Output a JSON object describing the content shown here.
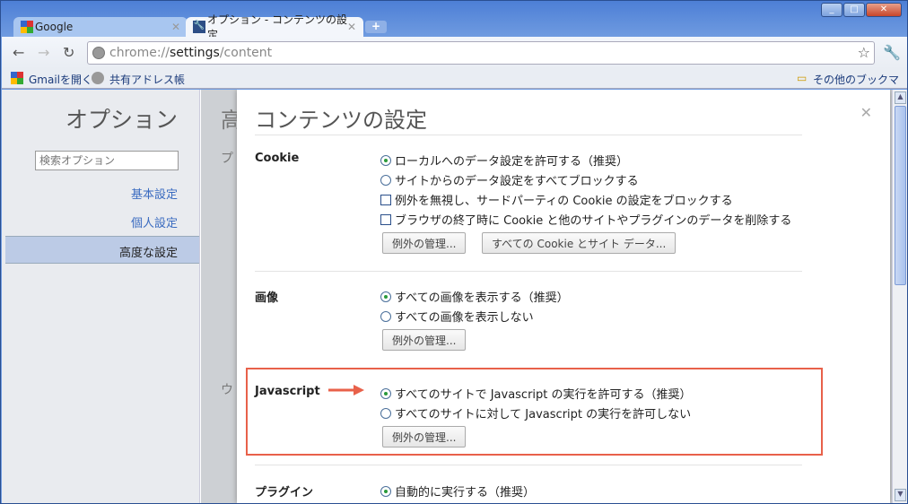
{
  "tabs": [
    {
      "label": "Google",
      "icon": "google-icon"
    },
    {
      "label": "オプション - コンテンツの設定",
      "icon": "wrench-icon"
    }
  ],
  "url": {
    "prefix": "chrome://",
    "host": "settings",
    "path": "/content"
  },
  "bookmarks": [
    {
      "label": "Gmailを開く"
    },
    {
      "label": "共有アドレス帳"
    }
  ],
  "other_bookmarks": "その他のブックマーク",
  "sidebar": {
    "title": "オプション",
    "search_placeholder": "検索オプション",
    "items": [
      {
        "label": "基本設定"
      },
      {
        "label": "個人設定"
      },
      {
        "label": "高度な設定",
        "selected": true
      }
    ]
  },
  "behind": [
    "高",
    "プ",
    "ウ"
  ],
  "dialog": {
    "title": "コンテンツの設定",
    "cookie": {
      "label": "Cookie",
      "options": [
        "ローカルへのデータ設定を許可する（推奨）",
        "サイトからのデータ設定をすべてブロックする"
      ],
      "checks": [
        "例外を無視し、サードパーティの Cookie の設定をブロックする",
        "ブラウザの終了時に Cookie と他のサイトやプラグインのデータを削除する"
      ],
      "buttons": [
        "例外の管理...",
        "すべての Cookie とサイト データ..."
      ]
    },
    "images": {
      "label": "画像",
      "options": [
        "すべての画像を表示する（推奨）",
        "すべての画像を表示しない"
      ],
      "button": "例外の管理..."
    },
    "javascript": {
      "label": "Javascript",
      "options": [
        "すべてのサイトで Javascript の実行を許可する（推奨）",
        "すべてのサイトに対して Javascript の実行を許可しない"
      ],
      "button": "例外の管理..."
    },
    "plugins": {
      "label": "プラグイン",
      "options": [
        "自動的に実行する（推奨）"
      ]
    }
  },
  "colors": {
    "highlight": "#e8614a"
  }
}
